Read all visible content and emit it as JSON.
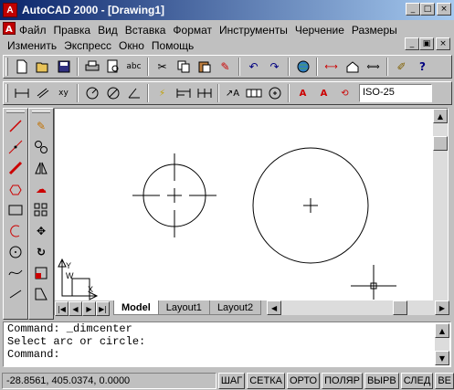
{
  "window": {
    "app_icon": "autocad-a-icon",
    "title": "AutoCAD 2000 - [Drawing1]",
    "buttons": {
      "minimize": "_",
      "maximize": "□",
      "close": "×"
    }
  },
  "menu": {
    "row1": [
      "Файл",
      "Правка",
      "Вид",
      "Вставка",
      "Формат",
      "Инструменты",
      "Черчение",
      "Размеры"
    ],
    "row2": [
      "Изменить",
      "Экспресс",
      "Окно",
      "Помощь"
    ],
    "doc_buttons": {
      "minimize": "_",
      "restore": "▣",
      "close": "×"
    }
  },
  "toolbar_standard": {
    "icons": [
      "new-icon",
      "open-icon",
      "save-icon",
      "print-icon",
      "print-preview-icon",
      "spell-check-icon",
      "cut-icon",
      "copy-icon",
      "paste-icon",
      "match-properties-icon",
      "undo-icon",
      "redo-icon",
      "internet-icon",
      "distance-icon",
      "insert-block-icon",
      "tracking-icon",
      "pen-icon",
      "help-icon"
    ]
  },
  "toolbar_dimension": {
    "icons": [
      "linear-dim-icon",
      "aligned-dim-icon",
      "ordinate-dim-icon",
      "radius-dim-icon",
      "diameter-dim-icon",
      "angular-dim-icon",
      "quick-dim-icon",
      "baseline-dim-icon",
      "continue-dim-icon",
      "leader-icon",
      "tolerance-icon",
      "center-mark-icon",
      "dim-edit-icon",
      "dim-text-edit-icon",
      "dim-update-icon"
    ],
    "dimstyle": "ISO-25"
  },
  "draw_toolbar": {
    "icons": [
      "line-icon",
      "construction-line-icon",
      "polyline-icon",
      "polygon-icon",
      "rectangle-icon",
      "arc-icon",
      "circle-icon",
      "spline-icon",
      "ellipse-icon"
    ]
  },
  "modify_toolbar": {
    "icons": [
      "erase-icon",
      "copy-object-icon",
      "mirror-icon",
      "offset-icon",
      "array-icon",
      "move-icon",
      "rotate-icon",
      "scale-icon",
      "stretch-icon"
    ]
  },
  "layout_tabs": [
    "Model",
    "Layout1",
    "Layout2"
  ],
  "ucs_labels": {
    "y": "Y",
    "w": "W",
    "x": "X"
  },
  "command_window": {
    "lines": [
      "Command: _dimcenter",
      "Select arc or circle:",
      "Command:"
    ]
  },
  "status_bar": {
    "coordinates": "-28.8561, 405.0374, 0.0000",
    "toggles": [
      "ШАГ",
      "СЕТКА",
      "ОРТО",
      "ПОЛЯР",
      "ВЫРВ",
      "СЛЕД",
      "ВЕ"
    ]
  },
  "colors": {
    "title_start": "#0a246a",
    "title_end": "#a6caf0",
    "face": "#c0c0c0",
    "canvas": "#ffffff"
  }
}
